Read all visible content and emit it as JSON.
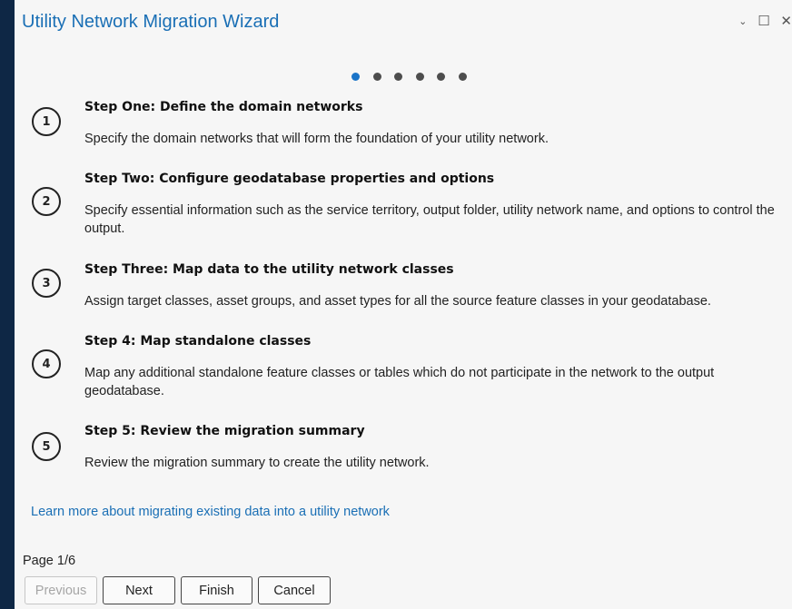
{
  "window": {
    "title": "Utility Network Migration Wizard",
    "controls": {
      "dropdown": "⌄",
      "maximize": "☐",
      "close": "✕"
    }
  },
  "pagination": {
    "total_dots": 6,
    "active_index": 0,
    "accent_color": "#1a74c8"
  },
  "steps": [
    {
      "number": "1",
      "title": "Step One: Define the domain networks",
      "description": "Specify the domain networks that will form the foundation of your utility network."
    },
    {
      "number": "2",
      "title": "Step Two: Configure geodatabase properties and options",
      "description": "Specify essential information such as the service territory, output folder, utility network name, and options to control the output."
    },
    {
      "number": "3",
      "title": "Step Three: Map data to the utility network classes",
      "description": "Assign target classes, asset groups, and asset types for all the source feature classes in your geodatabase."
    },
    {
      "number": "4",
      "title": "Step 4: Map standalone classes",
      "description": "Map any additional standalone feature classes or tables which do not participate in the network to the output geodatabase."
    },
    {
      "number": "5",
      "title": "Step 5: Review the migration summary",
      "description": "Review the migration summary to create the utility network."
    }
  ],
  "learn_more_link": "Learn more about migrating existing data into a utility network",
  "page_indicator": "Page 1/6",
  "buttons": {
    "previous": "Previous",
    "next": "Next",
    "finish": "Finish",
    "cancel": "Cancel"
  }
}
